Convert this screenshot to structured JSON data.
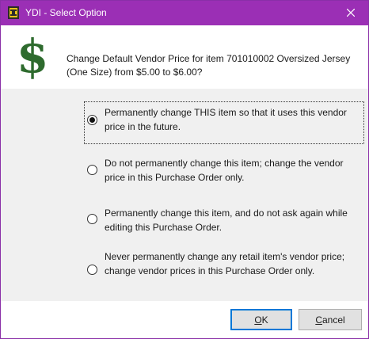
{
  "window": {
    "title": "YDI - Select Option",
    "app_icon": "ydi-app-icon",
    "close_icon": "close-icon",
    "accent_color": "#9b2fb5"
  },
  "header": {
    "icon": "dollar-sign-icon",
    "icon_color": "#2e6b2e",
    "icon_glyph": "$",
    "question": "Change Default Vendor Price for item 701010002 Oversized Jersey (One Size) from $5.00 to $6.00?"
  },
  "options": [
    {
      "label": "Permanently change THIS item so that it uses this vendor price in the future.",
      "selected": true
    },
    {
      "label": "Do not permanently change this item; change the vendor price in this Purchase Order only.",
      "selected": false
    },
    {
      "label": "Permanently change this item, and do not ask again while editing this Purchase Order.",
      "selected": false
    },
    {
      "label": "Never permanently change any retail item's vendor price; change vendor prices in this Purchase Order only.",
      "selected": false
    }
  ],
  "buttons": {
    "ok": {
      "mnemonic": "O",
      "rest": "K"
    },
    "cancel": {
      "mnemonic": "C",
      "rest": "ancel"
    }
  }
}
